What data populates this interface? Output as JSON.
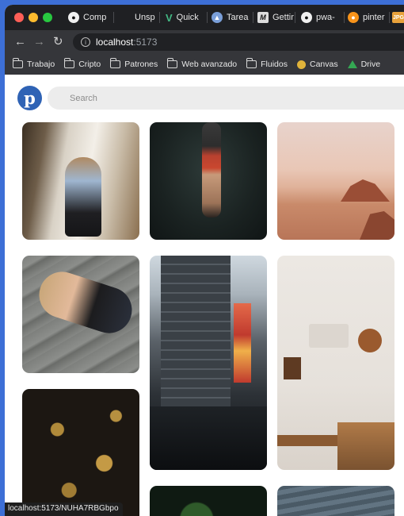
{
  "browser": {
    "tabs": [
      {
        "label": "Comp",
        "icon": "github-icon"
      },
      {
        "label": "Unsp",
        "icon": "unsplash-icon"
      },
      {
        "label": "Quick",
        "icon": "vue-icon"
      },
      {
        "label": "Tarea",
        "icon": "gdrive-icon"
      },
      {
        "label": "Gettin",
        "icon": "medium-icon"
      },
      {
        "label": "pwa-",
        "icon": "github-icon"
      },
      {
        "label": "pinter",
        "icon": "pinterest-fav-icon"
      },
      {
        "label": "JPG",
        "icon": "jpg-icon"
      }
    ],
    "url_host": "localhost",
    "url_port": ":5173",
    "bookmarks": [
      {
        "label": "Trabajo",
        "icon": "folder-icon"
      },
      {
        "label": "Cripto",
        "icon": "folder-icon"
      },
      {
        "label": "Patrones",
        "icon": "folder-icon"
      },
      {
        "label": "Web avanzado",
        "icon": "folder-icon"
      },
      {
        "label": "Fluidos",
        "icon": "folder-icon"
      },
      {
        "label": "Canvas",
        "icon": "canvas-icon"
      },
      {
        "label": "Drive",
        "icon": "gdrive-icon"
      }
    ],
    "status_url": "localhost:5173/NUHA7RBGbpo"
  },
  "app": {
    "logo_letter": "p",
    "search_placeholder": "Search"
  },
  "pins": [
    {
      "name": "pin-woman-window"
    },
    {
      "name": "pin-diver-underwater"
    },
    {
      "name": "pin-desert-rock"
    },
    {
      "name": "pin-woman-stairs"
    },
    {
      "name": "pin-city-building"
    },
    {
      "name": "pin-interior-shelves"
    },
    {
      "name": "pin-golden-floral"
    },
    {
      "name": "pin-green-plant"
    },
    {
      "name": "pin-sea-water"
    }
  ],
  "colors": {
    "desktop": "#3d6fd6",
    "tabbar": "#1f2023",
    "toolbar": "#35363a",
    "pinterest_logo": "#2f63b5",
    "search_bg": "#ececec"
  }
}
